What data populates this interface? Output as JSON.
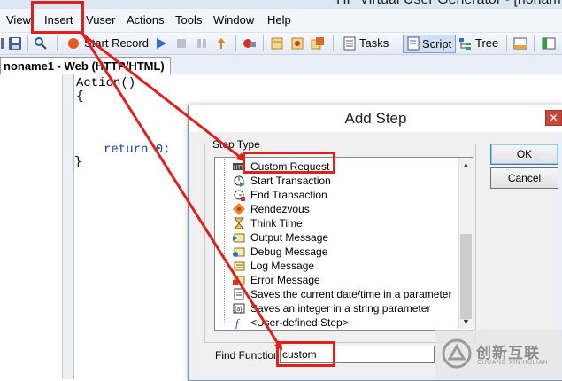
{
  "app": {
    "title": "HP Virtual User Generator - [nonam"
  },
  "menu": {
    "view": "View",
    "insert": "Insert",
    "vuser": "Vuser",
    "actions": "Actions",
    "tools": "Tools",
    "window": "Window",
    "help": "Help"
  },
  "toolbar": {
    "start_record": "Start Record",
    "tasks": "Tasks",
    "script": "Script",
    "tree": "Tree"
  },
  "document_tab": {
    "label": "noname1 - Web (HTTP/HTML)"
  },
  "editor": {
    "lines": [
      "Action()",
      "{",
      "return 0;",
      "}"
    ]
  },
  "dialog": {
    "title": "Add Step",
    "close_glyph": "✕",
    "step_type_label": "Step Type",
    "steps": [
      {
        "label": "Custom Request",
        "icon": "http-request-icon"
      },
      {
        "label": "Start Transaction",
        "icon": "start-transaction-icon"
      },
      {
        "label": "End Transaction",
        "icon": "end-transaction-icon"
      },
      {
        "label": "Rendezvous",
        "icon": "rendezvous-icon"
      },
      {
        "label": "Think Time",
        "icon": "hourglass-icon"
      },
      {
        "label": "Output Message",
        "icon": "output-message-icon"
      },
      {
        "label": "Debug Message",
        "icon": "debug-message-icon"
      },
      {
        "label": "Log Message",
        "icon": "log-message-icon"
      },
      {
        "label": "Error Message",
        "icon": "error-message-icon"
      },
      {
        "label": "Saves the current date/time in a parameter",
        "icon": "save-datetime-icon"
      },
      {
        "label": "Saves an integer in a string parameter",
        "icon": "save-integer-icon"
      },
      {
        "label": "<User-defined Step>",
        "icon": "user-defined-step-icon"
      }
    ],
    "ok_label": "OK",
    "cancel_label": "Cancel",
    "find_label": "Find Function:",
    "find_value": "custom"
  },
  "annotation_color": "#e0201c",
  "watermark": {
    "cn": "创新互联",
    "en": "CHUANG XIN HULIAN"
  }
}
